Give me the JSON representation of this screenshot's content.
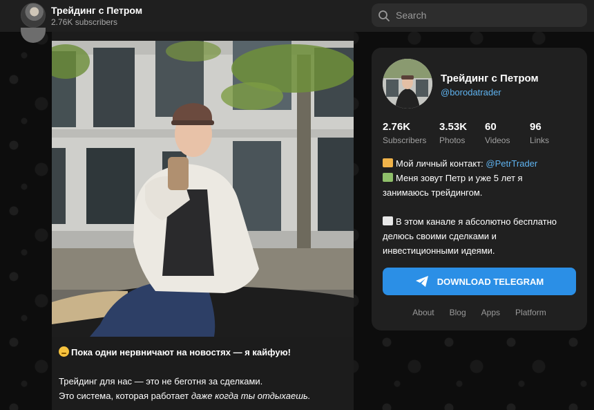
{
  "header": {
    "channel_name": "Трейдинг с Петром",
    "subscribers": "2.76K subscribers"
  },
  "search": {
    "placeholder": "Search"
  },
  "post": {
    "caption_line1": "Пока одни нервничают на новостях — я кайфую!",
    "caption_line2": "Трейдинг для нас — это не беготня за сделками.",
    "caption_line3_plain": "Это система, которая работает ",
    "caption_line3_italic": "даже когда ты отдыхаешь."
  },
  "card": {
    "name": "Трейдинг с Петром",
    "handle": "@borodatrader",
    "stats": [
      {
        "value": "2.76K",
        "label": "Subscribers"
      },
      {
        "value": "3.53K",
        "label": "Photos"
      },
      {
        "value": "60",
        "label": "Videos"
      },
      {
        "value": "96",
        "label": "Links"
      }
    ],
    "desc_contact_text": "Мой личный контакт: ",
    "desc_contact_link": "@PetrTrader",
    "desc_line2": "Меня зовут Петр и уже 5 лет я",
    "desc_line3": "занимаюсь трейдингом.",
    "desc_line4": "В этом канале я абсолютно бесплатно",
    "desc_line5": "делюсь своими сделками и",
    "desc_line6": "инвестиционными идеями.",
    "download_label": "DOWNLOAD TELEGRAM",
    "links": [
      "About",
      "Blog",
      "Apps",
      "Platform"
    ]
  },
  "colors": {
    "accent": "#2b8fe6",
    "link": "#5fb3f0",
    "header_bg": "#1f1f1f",
    "card_bg": "#202020"
  }
}
